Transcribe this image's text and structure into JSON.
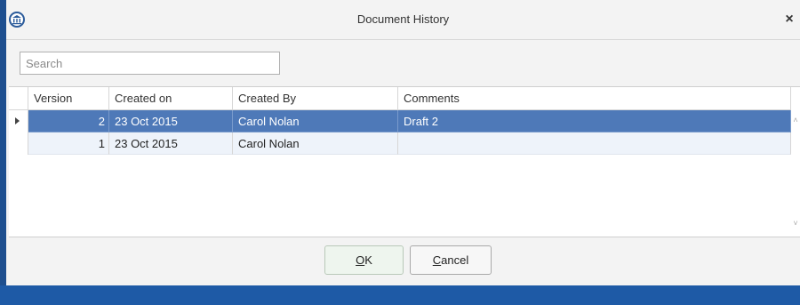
{
  "window": {
    "title": "Document History",
    "close_glyph": "×",
    "app_icon": "institution-icon"
  },
  "search": {
    "placeholder": "Search",
    "value": ""
  },
  "grid": {
    "columns": [
      "Version",
      "Created on",
      "Created By",
      "Comments"
    ],
    "rows": [
      {
        "version": "2",
        "created_on": "23 Oct 2015",
        "created_by": "Carol Nolan",
        "comments": "Draft 2",
        "selected": true
      },
      {
        "version": "1",
        "created_on": "23 Oct 2015",
        "created_by": "Carol Nolan",
        "comments": "",
        "selected": false
      }
    ]
  },
  "buttons": {
    "ok": {
      "mnemonic": "O",
      "rest": "K"
    },
    "cancel": {
      "mnemonic": "C",
      "rest": "ancel"
    }
  },
  "colors": {
    "selection": "#4e79b8",
    "frame": "#1e5aa6"
  }
}
